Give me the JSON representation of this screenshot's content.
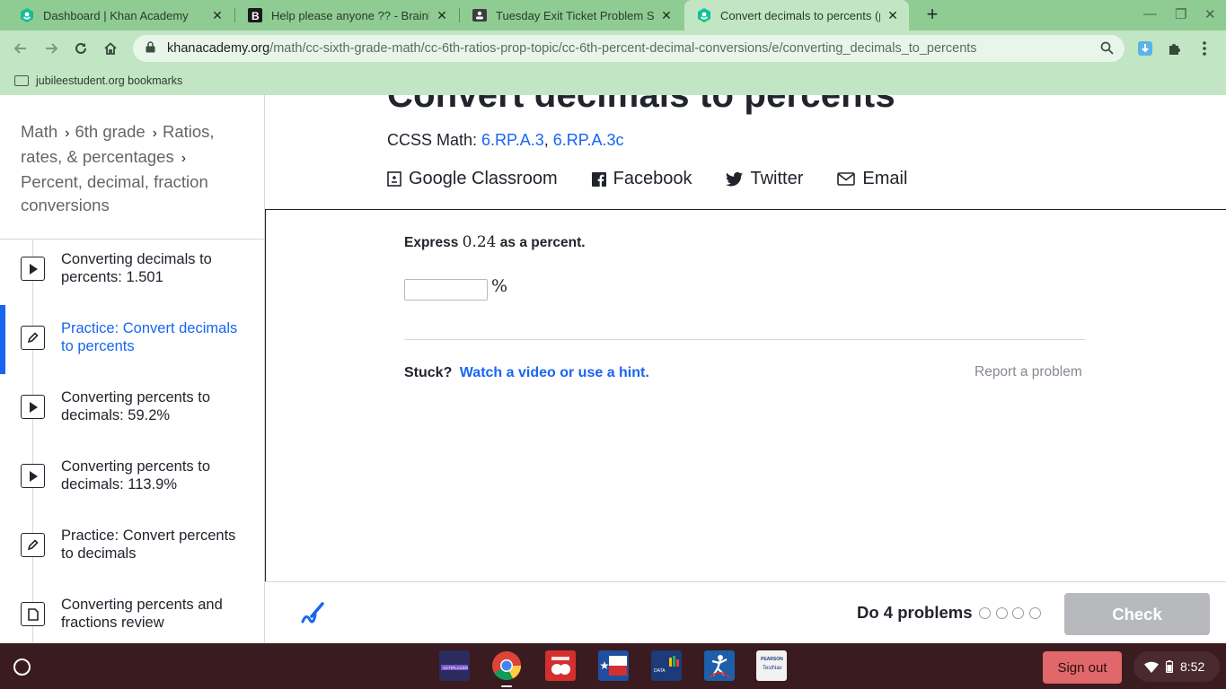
{
  "browser": {
    "tabs": [
      {
        "title": "Dashboard | Khan Academy",
        "icon": "khan-academy-icon",
        "active": false
      },
      {
        "title": "Help please anyone ?? - Brainly.co",
        "icon": "brainly-icon",
        "active": false
      },
      {
        "title": "Tuesday Exit Ticket Problem Solvi",
        "icon": "classroom-icon",
        "active": false
      },
      {
        "title": "Convert decimals to percents (pr",
        "icon": "khan-academy-icon",
        "active": true
      }
    ],
    "url_host": "khanacademy.org",
    "url_path": "/math/cc-sixth-grade-math/cc-6th-ratios-prop-topic/cc-6th-percent-decimal-conversions/e/converting_decimals_to_percents",
    "bookmark": "jubileestudent.org bookmarks"
  },
  "sidebar": {
    "breadcrumbs": [
      "Math",
      "6th grade",
      "Ratios, rates, & percentages",
      "Percent, decimal, fraction conversions"
    ],
    "lessons": [
      {
        "label": "Converting decimals to percents: 1.501",
        "icon": "play-icon",
        "active": false
      },
      {
        "label": "Practice: Convert decimals to percents",
        "icon": "pencil-icon",
        "active": true
      },
      {
        "label": "Converting percents to decimals: 59.2%",
        "icon": "play-icon",
        "active": false
      },
      {
        "label": "Converting percents to decimals: 113.9%",
        "icon": "play-icon",
        "active": false
      },
      {
        "label": "Practice: Convert percents to decimals",
        "icon": "pencil-icon",
        "active": false
      },
      {
        "label": "Converting percents and fractions review",
        "icon": "article-icon",
        "active": false
      }
    ]
  },
  "main": {
    "title": "Convert decimals to percents",
    "ccss_label": "CCSS Math: ",
    "ccss_links": [
      "6.RP.A.3",
      "6.RP.A.3c"
    ],
    "ccss_sep": ", ",
    "share": [
      {
        "label": "Google Classroom",
        "icon": "google-classroom-icon"
      },
      {
        "label": "Facebook",
        "icon": "facebook-icon"
      },
      {
        "label": "Twitter",
        "icon": "twitter-icon"
      },
      {
        "label": "Email",
        "icon": "email-icon"
      }
    ]
  },
  "exercise": {
    "question_prefix": "Express ",
    "question_value": "0.24",
    "question_suffix": " as a percent.",
    "answer_value": "",
    "unit": "%",
    "stuck_label": "Stuck?",
    "hint_link": "Watch a video or use a hint.",
    "report_link": "Report a problem"
  },
  "footer": {
    "do_problems": "Do 4 problems",
    "progress_total": 4,
    "progress_done": 0,
    "check_label": "Check"
  },
  "shelf": {
    "apps": [
      {
        "name": "actiplacer",
        "label": "ACTIPLACER",
        "color": "#2b2b5e"
      },
      {
        "name": "chrome",
        "label": "",
        "color": "#3a1b1f"
      },
      {
        "name": "anonymous-alerts",
        "label": "Anonymous Alerts",
        "color": "#d32f2f"
      },
      {
        "name": "texas",
        "label": "",
        "color": "#1f4fa0"
      },
      {
        "name": "data-manager",
        "label": "DATA MANAGER",
        "color": "#1b3b7a"
      },
      {
        "name": "dancer",
        "label": "",
        "color": "#1d5fa8"
      },
      {
        "name": "pearson-testnav",
        "label": "PEARSON TestNav",
        "color": "#f2f2f2"
      }
    ],
    "signout_label": "Sign out",
    "time": "8:52"
  }
}
